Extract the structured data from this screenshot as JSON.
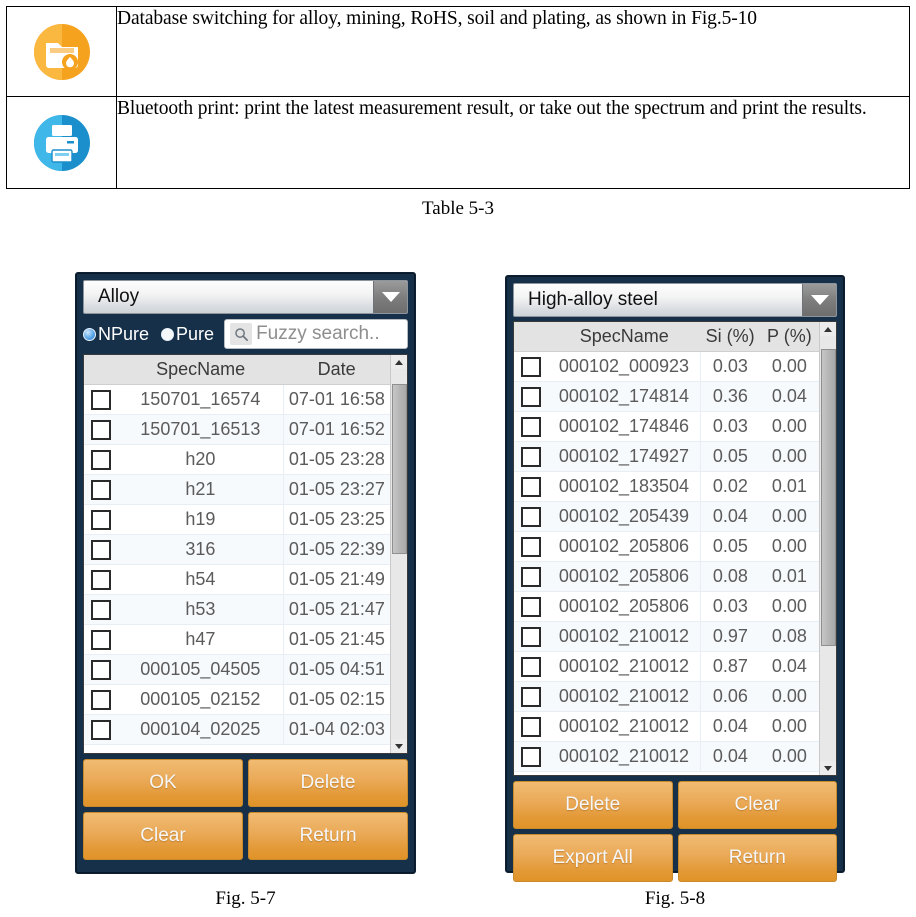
{
  "table": {
    "caption": "Table 5-3",
    "rows": [
      {
        "icon": "database-folder-icon",
        "icon_color": "#F5A21E",
        "text": "Database switching for alloy, mining, RoHS, soil and plating, as shown in Fig.5-10"
      },
      {
        "icon": "bluetooth-printer-icon",
        "icon_color": "#2BA8DE",
        "text": "Bluetooth print: print the latest measurement result, or take out the spectrum and print the results."
      }
    ]
  },
  "left_panel": {
    "caption": "Fig. 5-7",
    "dropdown": {
      "value": "Alloy",
      "arrow": "chevron-down-icon"
    },
    "radios": [
      {
        "label": "NPure",
        "selected": true
      },
      {
        "label": "Pure",
        "selected": false
      }
    ],
    "search": {
      "placeholder": "Fuzzy search..",
      "value": "",
      "icon": "search-icon"
    },
    "columns": [
      "",
      "SpecName",
      "Date"
    ],
    "rows": [
      {
        "name": "150701_16574",
        "date": "07-01 16:58",
        "checked": false
      },
      {
        "name": "150701_16513",
        "date": "07-01 16:52",
        "checked": false
      },
      {
        "name": "h20",
        "date": "01-05 23:28",
        "checked": false
      },
      {
        "name": "h21",
        "date": "01-05 23:27",
        "checked": false
      },
      {
        "name": "h19",
        "date": "01-05 23:25",
        "checked": false
      },
      {
        "name": "316",
        "date": "01-05 22:39",
        "checked": false
      },
      {
        "name": "h54",
        "date": "01-05 21:49",
        "checked": false
      },
      {
        "name": "h53",
        "date": "01-05 21:47",
        "checked": false
      },
      {
        "name": "h47",
        "date": "01-05 21:45",
        "checked": false
      },
      {
        "name": "000105_04505",
        "date": "01-05 04:51",
        "checked": false
      },
      {
        "name": "000105_02152",
        "date": "01-05 02:15",
        "checked": false
      },
      {
        "name": "000104_02025",
        "date": "01-04 02:03",
        "checked": false
      }
    ],
    "buttons": [
      "OK",
      "Delete",
      "Clear",
      "Return"
    ],
    "scrollbar": {
      "thumb_top_pct": 4,
      "thumb_height_pct": 46
    }
  },
  "right_panel": {
    "caption": "Fig. 5-8",
    "dropdown": {
      "value": "High-alloy steel",
      "arrow": "chevron-down-icon"
    },
    "columns": [
      "",
      "SpecName",
      "Si (%)",
      "P (%)"
    ],
    "rows": [
      {
        "name": "000102_000923",
        "si": "0.03",
        "p": "0.00",
        "checked": false
      },
      {
        "name": "000102_174814",
        "si": "0.36",
        "p": "0.04",
        "checked": false
      },
      {
        "name": "000102_174846",
        "si": "0.03",
        "p": "0.00",
        "checked": false
      },
      {
        "name": "000102_174927",
        "si": "0.05",
        "p": "0.00",
        "checked": false
      },
      {
        "name": "000102_183504",
        "si": "0.02",
        "p": "0.01",
        "checked": false
      },
      {
        "name": "000102_205439",
        "si": "0.04",
        "p": "0.00",
        "checked": false
      },
      {
        "name": "000102_205806",
        "si": "0.05",
        "p": "0.00",
        "checked": false
      },
      {
        "name": "000102_205806",
        "si": "0.08",
        "p": "0.01",
        "checked": false
      },
      {
        "name": "000102_205806",
        "si": "0.03",
        "p": "0.00",
        "checked": false
      },
      {
        "name": "000102_210012",
        "si": "0.97",
        "p": "0.08",
        "checked": false
      },
      {
        "name": "000102_210012",
        "si": "0.87",
        "p": "0.04",
        "checked": false
      },
      {
        "name": "000102_210012",
        "si": "0.06",
        "p": "0.00",
        "checked": false
      },
      {
        "name": "000102_210012",
        "si": "0.04",
        "p": "0.00",
        "checked": false
      },
      {
        "name": "000102_210012",
        "si": "0.04",
        "p": "0.00",
        "checked": false
      }
    ],
    "buttons": [
      "Delete",
      "Clear",
      "Export All",
      "Return"
    ],
    "scrollbar": {
      "thumb_top_pct": 3,
      "thumb_height_pct": 70
    }
  },
  "colors": {
    "panel_bg": "#16304a",
    "button_orange": "#E89C3A",
    "radio_blue": "#5AA7E8"
  }
}
